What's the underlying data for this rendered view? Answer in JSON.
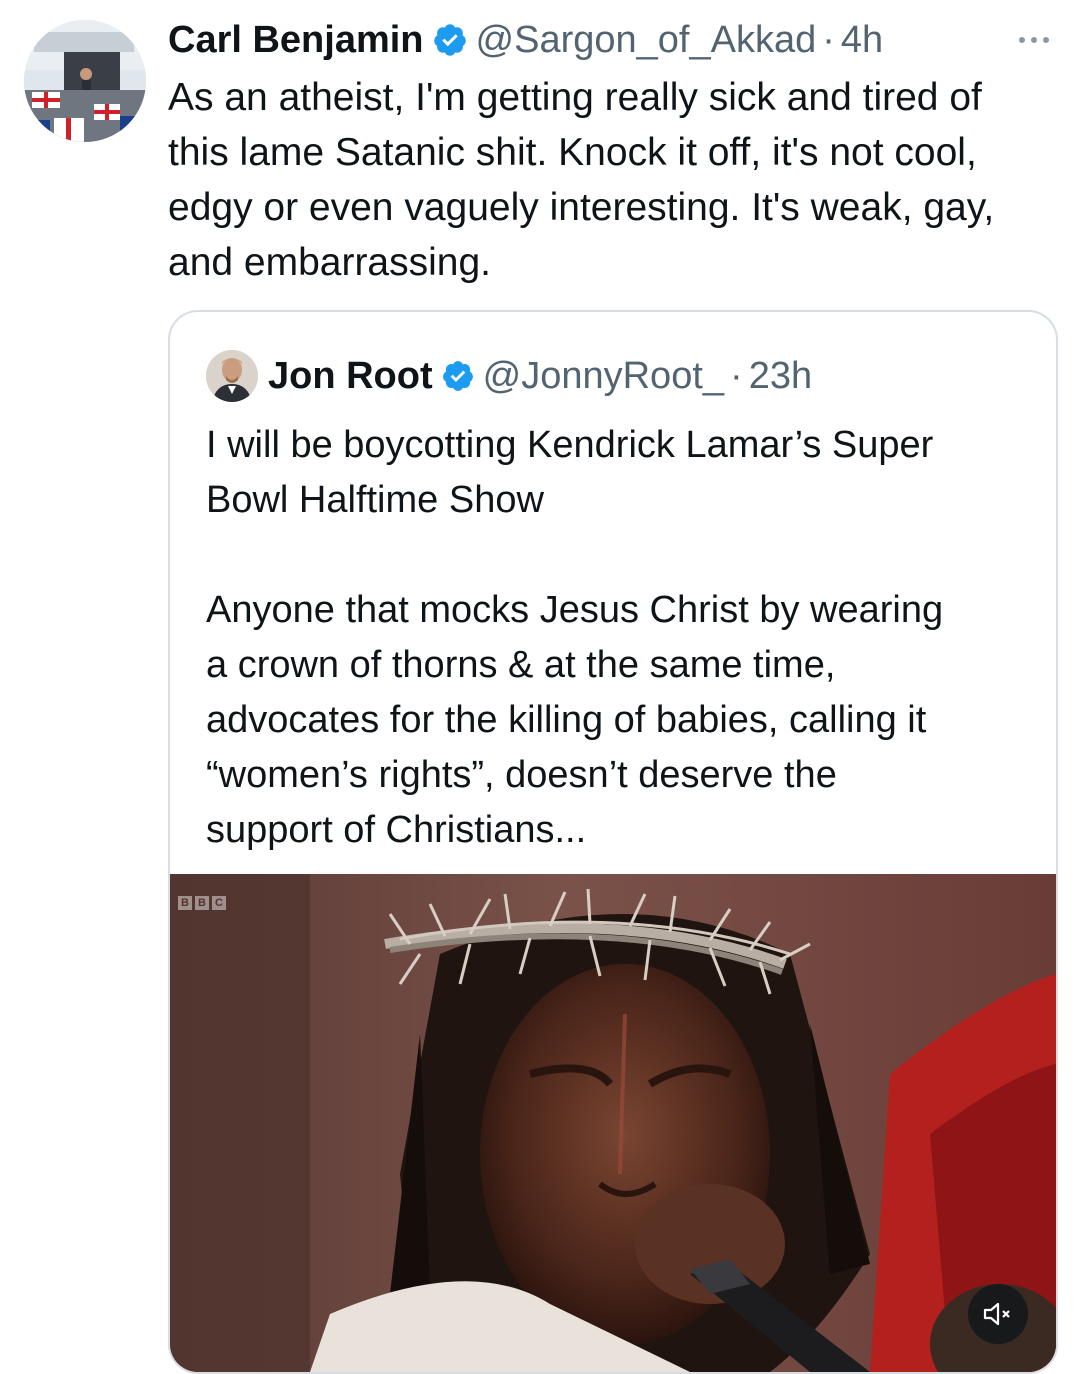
{
  "tweet": {
    "author": {
      "display_name": "Carl Benjamin",
      "handle": "@Sargon_of_Akkad",
      "time": "4h",
      "verified": true
    },
    "separator": "·",
    "text": "As an atheist, I'm getting really sick and tired of\nthis lame Satanic shit. Knock it off, it's not cool,\nedgy or even vaguely interesting. It's weak, gay,\nand embarrassing.",
    "more_icon": "more-horizontal-icon"
  },
  "quote": {
    "author": {
      "display_name": "Jon Root",
      "handle": "@JonnyRoot_",
      "time": "23h",
      "verified": true
    },
    "separator": "·",
    "text": "I will be boycotting Kendrick Lamar’s Super\nBowl Halftime Show\n\nAnyone that mocks Jesus Christ by wearing\na crown of thorns & at the same time,\nadvocates for the killing of babies, calling it\n“women’s rights”, doesn’t deserve the\nsupport of Christians...",
    "media": {
      "broadcaster_letters": [
        "B",
        "B",
        "C"
      ],
      "mute_icon": "volume-muted-icon"
    }
  },
  "colors": {
    "text_primary": "#0f1419",
    "text_secondary": "#536471",
    "verified_blue": "#1d9bf0",
    "border": "#d6dde3"
  }
}
